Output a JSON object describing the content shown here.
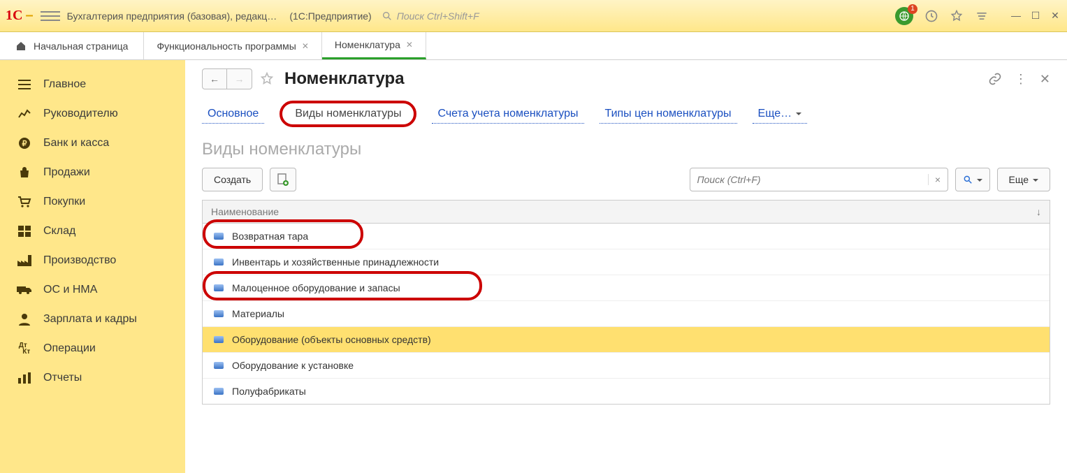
{
  "titlebar": {
    "app_title": "Бухгалтерия предприятия (базовая), редакц…",
    "app_sub": "(1С:Предприятие)",
    "search_placeholder": "Поиск Ctrl+Shift+F",
    "badge": "1"
  },
  "tabs": {
    "home": "Начальная страница",
    "items": [
      {
        "label": "Функциональность программы",
        "active": false
      },
      {
        "label": "Номенклатура",
        "active": true
      }
    ]
  },
  "sidebar": {
    "items": [
      {
        "label": "Главное",
        "icon": "menu"
      },
      {
        "label": "Руководителю",
        "icon": "chart"
      },
      {
        "label": "Банк и касса",
        "icon": "ruble"
      },
      {
        "label": "Продажи",
        "icon": "bag"
      },
      {
        "label": "Покупки",
        "icon": "cart"
      },
      {
        "label": "Склад",
        "icon": "boxes"
      },
      {
        "label": "Производство",
        "icon": "factory"
      },
      {
        "label": "ОС и НМА",
        "icon": "truck"
      },
      {
        "label": "Зарплата и кадры",
        "icon": "user"
      },
      {
        "label": "Операции",
        "icon": "dtkt"
      },
      {
        "label": "Отчеты",
        "icon": "bars"
      }
    ]
  },
  "page": {
    "title": "Номенклатура",
    "subnav": {
      "main": "Основное",
      "active": "Виды номенклатуры",
      "links": [
        "Счета учета номенклатуры",
        "Типы цен номенклатуры"
      ],
      "more": "Еще…"
    },
    "section": "Виды номенклатуры",
    "toolbar": {
      "create": "Создать",
      "search_placeholder": "Поиск (Ctrl+F)",
      "more": "Еще"
    },
    "table": {
      "header": "Наименование",
      "rows": [
        {
          "label": "Возвратная тара",
          "highlighted": true
        },
        {
          "label": "Инвентарь и хозяйственные принадлежности"
        },
        {
          "label": "Малоценное оборудование и запасы",
          "highlighted": true
        },
        {
          "label": "Материалы"
        },
        {
          "label": "Оборудование (объекты основных средств)",
          "selected": true
        },
        {
          "label": "Оборудование к установке"
        },
        {
          "label": "Полуфабрикаты"
        }
      ]
    }
  }
}
